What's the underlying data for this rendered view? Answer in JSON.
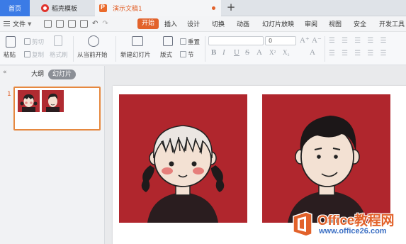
{
  "tabs": [
    {
      "label": "首页"
    },
    {
      "label": "稻壳模板"
    },
    {
      "label": "演示文稿1"
    }
  ],
  "new_tab_label": "+",
  "menu": {
    "file_label": "文件",
    "items": [
      "开始",
      "插入",
      "设计",
      "切换",
      "动画",
      "幻灯片放映",
      "审阅",
      "视图",
      "安全",
      "开发工具"
    ]
  },
  "ribbon": {
    "paste": "粘贴",
    "cut": "剪切",
    "copy": "复制",
    "format_painter": "格式刷",
    "play_from_current": "从当前开始",
    "new_slide": "新建幻灯片",
    "layout": "版式",
    "reset": "重置",
    "section": "节",
    "font_name": "",
    "font_size": "0",
    "grow_font": "A⁺",
    "shrink_font": "A⁻",
    "format_glyphs": [
      "B",
      "I",
      "U",
      "S",
      "A",
      "X²",
      "X₂",
      "A"
    ]
  },
  "left_pane": {
    "collapse_glyph": "«",
    "outline_tab": "大纲",
    "slides_tab": "幻灯片",
    "slide_number": "1"
  },
  "watermark": {
    "title": "Office教程网",
    "url": "www.office26.com"
  },
  "colors": {
    "accent": "#e2622b",
    "home_tab": "#3b7be6",
    "artwork_bg": "#b0262d"
  }
}
